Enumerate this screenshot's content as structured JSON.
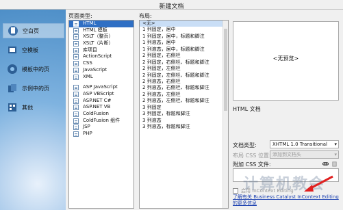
{
  "window": {
    "title": "新建文档"
  },
  "nav": [
    {
      "label": "空白页",
      "icon": "blank-page-icon",
      "selected": true
    },
    {
      "label": "空模板",
      "icon": "blank-template-icon"
    },
    {
      "label": "模板中的页",
      "icon": "template-page-icon"
    },
    {
      "label": "示例中的页",
      "icon": "sample-page-icon"
    },
    {
      "label": "其他",
      "icon": "other-icon"
    }
  ],
  "page_type": {
    "label": "页面类型:",
    "items": [
      "HTML",
      "HTML 模板",
      "XSLT（整页）",
      "XSLT（片断）",
      "库项目",
      "ActionScript",
      "CSS",
      "JavaScript",
      "XML",
      "",
      "ASP JavaScript",
      "ASP VBScript",
      "ASP.NET C#",
      "ASP.NET VB",
      "ColdFusion",
      "ColdFusion 组件",
      "JSP",
      "PHP"
    ],
    "selected": "HTML"
  },
  "layout": {
    "label": "布局:",
    "items": [
      "<无>",
      "1 列固定，居中",
      "1 列固定，居中，标题和脚注",
      "1 列液态，居中",
      "1 列液态，居中，标题和脚注",
      "2 列固定，右侧栏",
      "2 列固定，右侧栏、标题和脚注",
      "2 列固定，左侧栏",
      "2 列固定，左侧栏、标题和脚注",
      "2 列液态，右侧栏",
      "2 列液态，右侧栏、标题和脚注",
      "2 列液态，左侧栏",
      "2 列液态，左侧栏、标题和脚注",
      "3 列固定",
      "3 列固定，标题和脚注",
      "3 列液态",
      "3 列液态，标题和脚注"
    ],
    "selected": "<无>"
  },
  "preview": {
    "text": "<无预览>",
    "caption": "HTML 文档"
  },
  "doctype": {
    "label": "文档类型:",
    "value": "XHTML 1.0 Transitional"
  },
  "layout_css": {
    "label": "布局 CSS 位置:",
    "value": "添加到文档头"
  },
  "attach_css": {
    "label": "附加 CSS 文件:"
  },
  "enable_incontext": {
    "label": "启用 InContext Editing"
  },
  "help_link": "了解有关 Business Catalyst InContext Editing 的更多信息",
  "watermark": "计算机教会",
  "colors": {
    "selection": "#2f6fc4",
    "link": "#1a3fb0",
    "arrow": "#e02020"
  }
}
